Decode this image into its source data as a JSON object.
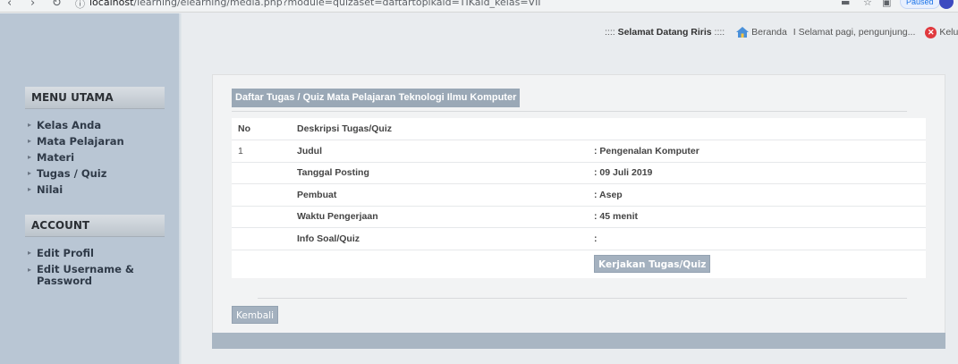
{
  "browser": {
    "back_glyph": "‹",
    "forward_glyph": "›",
    "reload_glyph": "↻",
    "info_glyph": "ⓘ",
    "url_host": "localhost",
    "url_path": "/learning/elearning/media.php?module=quizaset=daftartopikaid=TIKaid_kelas=VII",
    "paused_label": "Paused"
  },
  "sidebar": {
    "menu_heading": "MENU UTAMA",
    "menu_items": [
      "Kelas Anda",
      "Mata Pelajaran",
      "Materi",
      "Tugas / Quiz",
      "Nilai"
    ],
    "account_heading": "ACCOUNT",
    "account_items": [
      "Edit Profil",
      "Edit Username & Password"
    ]
  },
  "topbar": {
    "prefix": ":::: ",
    "welcome": "Selamat Datang Riris",
    "suffix": " ::::",
    "home": "Beranda",
    "greeting": "I Selamat pagi, pengunjung...",
    "exit": "Kelua"
  },
  "panel": {
    "title": "Daftar Tugas / Quiz Mata Pelajaran Teknologi Ilmu Komputer",
    "col_no": "No",
    "col_desc": "Deskripsi Tugas/Quiz",
    "row_no": "1",
    "rows": [
      {
        "label": "Judul",
        "value": ": Pengenalan Komputer"
      },
      {
        "label": "Tanggal Posting",
        "value": ": 09 Juli 2019"
      },
      {
        "label": "Pembuat",
        "value": ": Asep"
      },
      {
        "label": "Waktu Pengerjaan",
        "value": ": 45 menit"
      },
      {
        "label": "Info Soal/Quiz",
        "value": ":"
      }
    ],
    "start_button": "Kerjakan Tugas/Quiz",
    "back_button": "Kembali"
  },
  "colors": {
    "sidebar_bg": "#b9c6d4",
    "title_bg": "#9aa8b6",
    "button_bg": "#a4b1bf"
  }
}
